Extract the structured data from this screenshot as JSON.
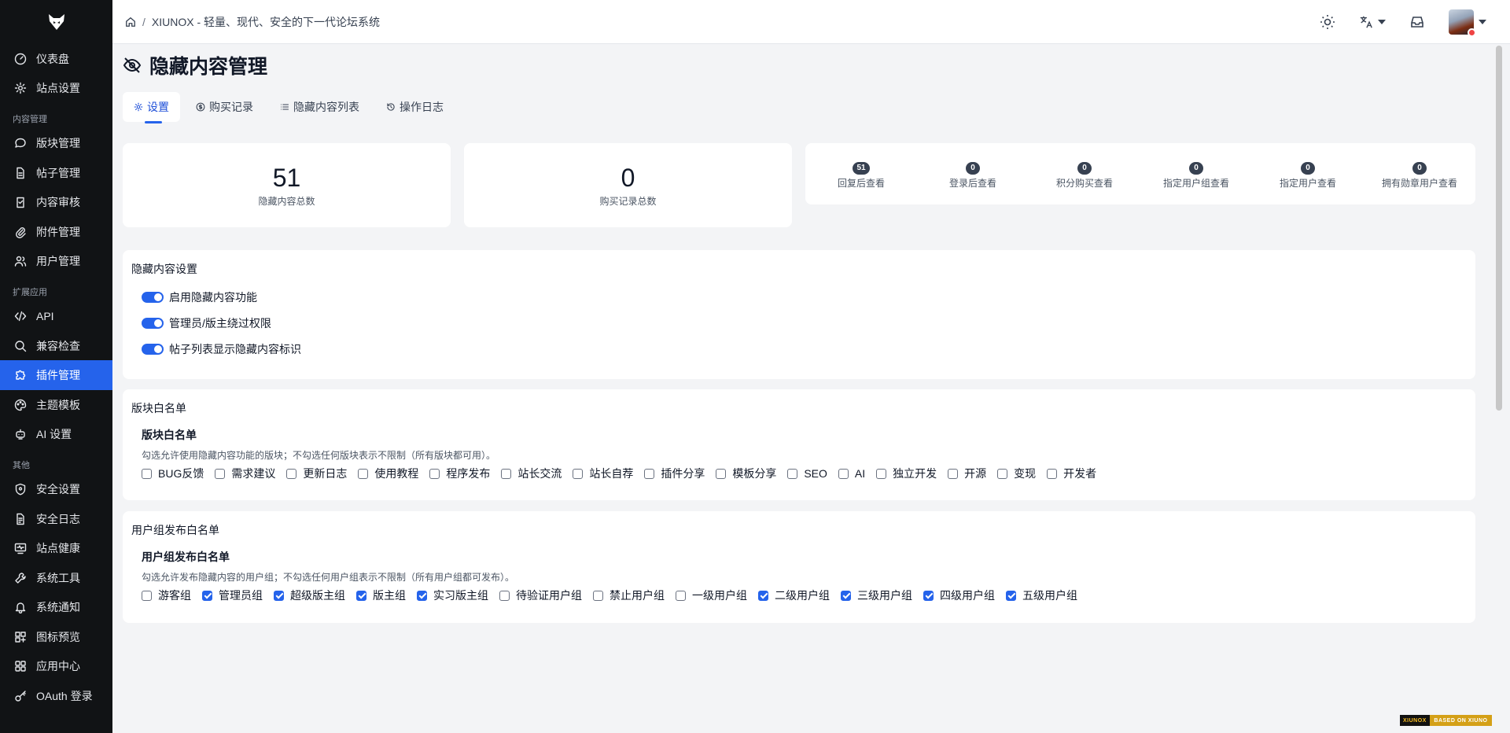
{
  "sidebar": {
    "logo_icon": "fox-logo-icon",
    "items_top": [
      {
        "label": "仪表盘",
        "icon": "dashboard-icon"
      },
      {
        "label": "站点设置",
        "icon": "gear-icon"
      }
    ],
    "section_content": "内容管理",
    "items_content": [
      {
        "label": "版块管理",
        "icon": "chat-icon"
      },
      {
        "label": "帖子管理",
        "icon": "document-icon"
      },
      {
        "label": "内容审核",
        "icon": "clipboard-check-icon"
      },
      {
        "label": "附件管理",
        "icon": "paperclip-icon"
      },
      {
        "label": "用户管理",
        "icon": "users-icon"
      }
    ],
    "section_ext": "扩展应用",
    "items_ext": [
      {
        "label": "API",
        "icon": "code-icon"
      },
      {
        "label": "兼容检查",
        "icon": "search-icon"
      },
      {
        "label": "插件管理",
        "icon": "puzzle-icon"
      },
      {
        "label": "主题模板",
        "icon": "palette-icon"
      },
      {
        "label": "AI 设置",
        "icon": "robot-icon"
      }
    ],
    "section_other": "其他",
    "items_other": [
      {
        "label": "安全设置",
        "icon": "shield-icon"
      },
      {
        "label": "安全日志",
        "icon": "log-icon"
      },
      {
        "label": "站点健康",
        "icon": "monitor-heart-icon"
      },
      {
        "label": "系统工具",
        "icon": "wrench-icon"
      },
      {
        "label": "系统通知",
        "icon": "bell-icon"
      },
      {
        "label": "图标预览",
        "icon": "grid-icon"
      },
      {
        "label": "应用中心",
        "icon": "apps-icon"
      },
      {
        "label": "OAuth 登录",
        "icon": "key-icon"
      }
    ],
    "active_item": "插件管理"
  },
  "header": {
    "breadcrumb_sep": "/",
    "breadcrumb_title": "XIUNOX - 轻量、现代、安全的下一代论坛系统"
  },
  "page": {
    "title": "隐藏内容管理",
    "title_icon": "eye-off-icon",
    "tabs": [
      {
        "label": "设置",
        "icon": "gear-icon"
      },
      {
        "label": "购买记录",
        "icon": "dollar-circle-icon"
      },
      {
        "label": "隐藏内容列表",
        "icon": "list-icon"
      },
      {
        "label": "操作日志",
        "icon": "history-icon"
      }
    ],
    "active_tab": "设置"
  },
  "stats": {
    "total_hidden": {
      "value": "51",
      "label": "隐藏内容总数"
    },
    "total_purchases": {
      "value": "0",
      "label": "购买记录总数"
    },
    "types": [
      {
        "count": "51",
        "label": "回复后查看"
      },
      {
        "count": "0",
        "label": "登录后查看"
      },
      {
        "count": "0",
        "label": "积分购买查看"
      },
      {
        "count": "0",
        "label": "指定用户组查看"
      },
      {
        "count": "0",
        "label": "指定用户查看"
      },
      {
        "count": "0",
        "label": "拥有勋章用户查看"
      }
    ]
  },
  "settings": {
    "title": "隐藏内容设置",
    "toggles": [
      {
        "label": "启用隐藏内容功能",
        "on": true
      },
      {
        "label": "管理员/版主绕过权限",
        "on": true
      },
      {
        "label": "帖子列表显示隐藏内容标识",
        "on": true
      }
    ]
  },
  "forum_whitelist": {
    "title": "版块白名单",
    "subtitle": "版块白名单",
    "desc": "勾选允许使用隐藏内容功能的版块；不勾选任何版块表示不限制（所有版块都可用）。",
    "options": [
      {
        "label": "BUG反馈",
        "checked": false
      },
      {
        "label": "需求建议",
        "checked": false
      },
      {
        "label": "更新日志",
        "checked": false
      },
      {
        "label": "使用教程",
        "checked": false
      },
      {
        "label": "程序发布",
        "checked": false
      },
      {
        "label": "站长交流",
        "checked": false
      },
      {
        "label": "站长自荐",
        "checked": false
      },
      {
        "label": "插件分享",
        "checked": false
      },
      {
        "label": "模板分享",
        "checked": false
      },
      {
        "label": "SEO",
        "checked": false
      },
      {
        "label": "AI",
        "checked": false
      },
      {
        "label": "独立开发",
        "checked": false
      },
      {
        "label": "开源",
        "checked": false
      },
      {
        "label": "变现",
        "checked": false
      },
      {
        "label": "开发者",
        "checked": false
      }
    ]
  },
  "group_whitelist": {
    "title": "用户组发布白名单",
    "subtitle": "用户组发布白名单",
    "desc": "勾选允许发布隐藏内容的用户组；不勾选任何用户组表示不限制（所有用户组都可发布）。",
    "options": [
      {
        "label": "游客组",
        "checked": false
      },
      {
        "label": "管理员组",
        "checked": true
      },
      {
        "label": "超级版主组",
        "checked": true
      },
      {
        "label": "版主组",
        "checked": true
      },
      {
        "label": "实习版主组",
        "checked": true
      },
      {
        "label": "待验证用户组",
        "checked": false
      },
      {
        "label": "禁止用户组",
        "checked": false
      },
      {
        "label": "一级用户组",
        "checked": false
      },
      {
        "label": "二级用户组",
        "checked": true
      },
      {
        "label": "三级用户组",
        "checked": true
      },
      {
        "label": "四级用户组",
        "checked": true
      },
      {
        "label": "五级用户组",
        "checked": true
      }
    ]
  },
  "footer": {
    "badge_left": "XIUNOX",
    "badge_right": "BASED ON XIUNO"
  },
  "colors": {
    "accent": "#2563eb",
    "sidebar_bg": "#111315",
    "page_bg": "#f3f4f6"
  }
}
